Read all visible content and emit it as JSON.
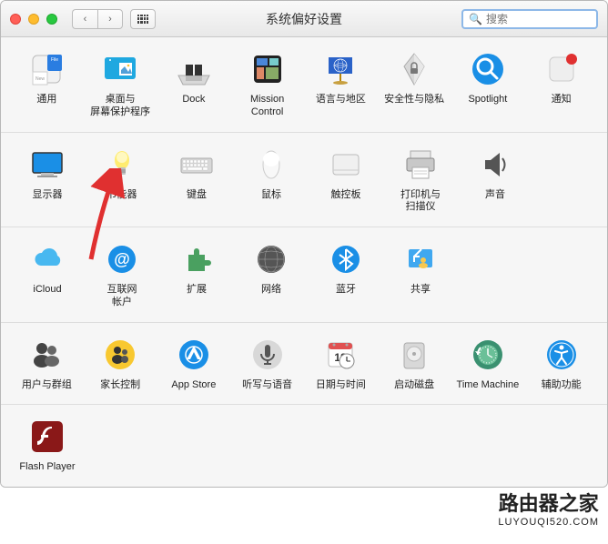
{
  "window": {
    "title": "系统偏好设置"
  },
  "search": {
    "placeholder": "搜索"
  },
  "rows": [
    [
      "通用",
      "桌面与\n屏幕保护程序",
      "Dock",
      "Mission\nControl",
      "语言与地区",
      "安全性与隐私",
      "Spotlight",
      "通知"
    ],
    [
      "显示器",
      "节能器",
      "键盘",
      "鼠标",
      "触控板",
      "打印机与\n扫描仪",
      "声音"
    ],
    [
      "iCloud",
      "互联网\n帐户",
      "扩展",
      "网络",
      "蓝牙",
      "共享"
    ],
    [
      "用户与群组",
      "家长控制",
      "App Store",
      "听写与语音",
      "日期与时间",
      "启动磁盘",
      "Time Machine",
      "辅助功能"
    ],
    [
      "Flash Player"
    ]
  ],
  "watermark": {
    "title": "路由器之家",
    "url": "LUYOUQI520.COM"
  }
}
